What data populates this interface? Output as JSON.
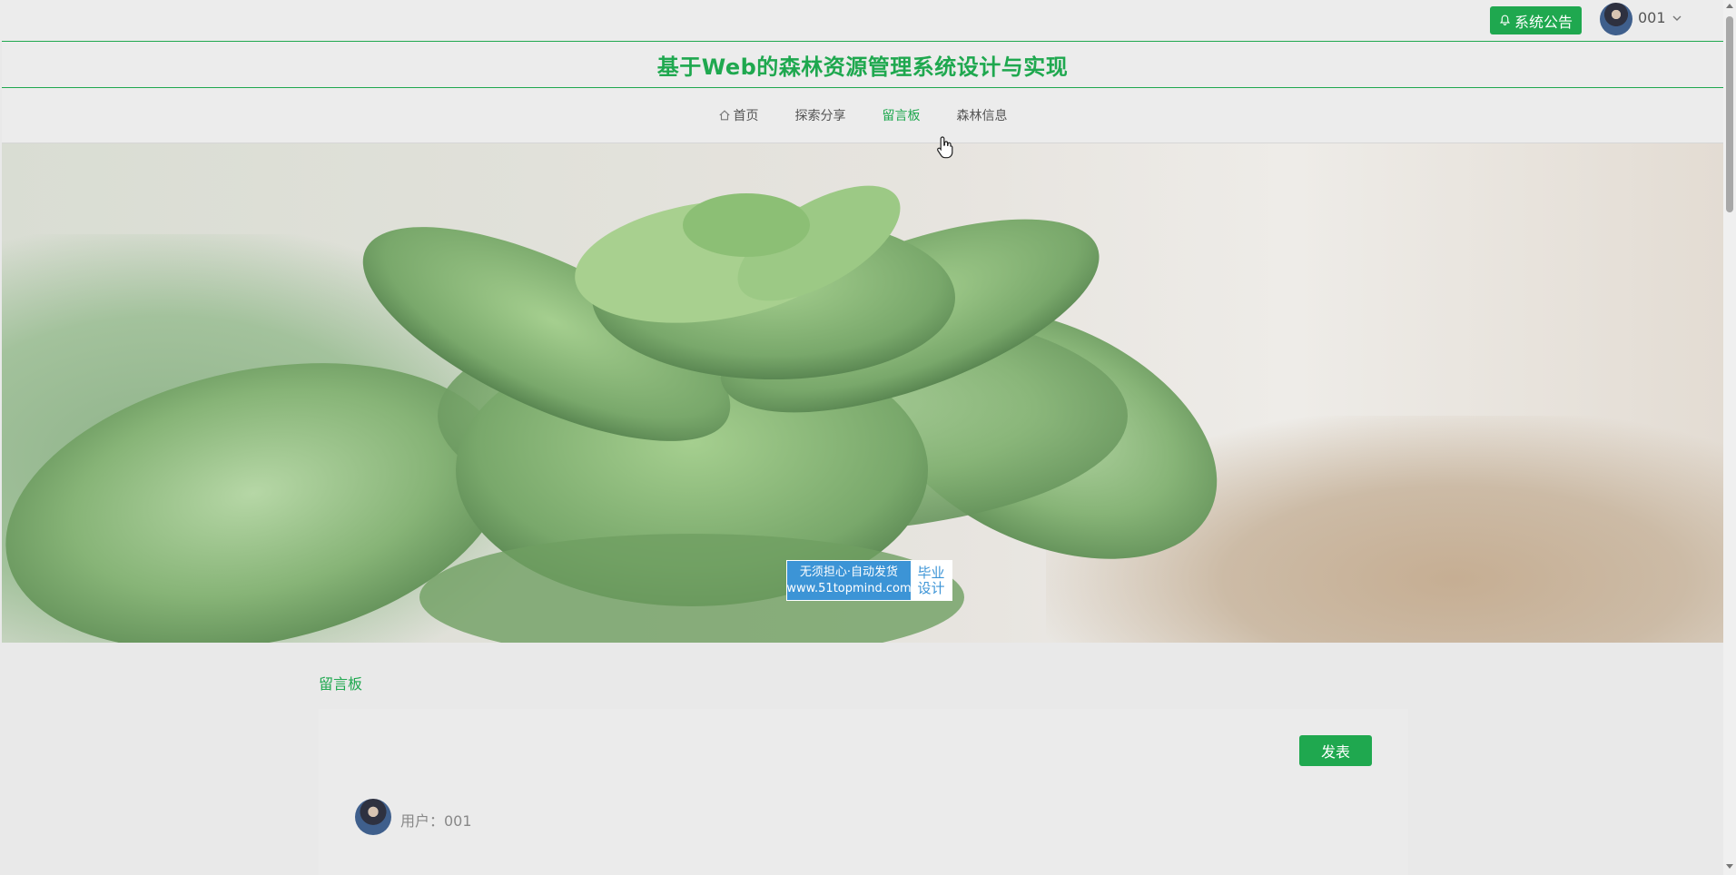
{
  "header": {
    "notice_button": "系统公告",
    "username": "001",
    "icons": {
      "notice": "bell-icon",
      "dropdown": "chevron-down-icon"
    }
  },
  "site": {
    "title": "基于Web的森林资源管理系统设计与实现"
  },
  "nav": {
    "items": [
      {
        "label": "首页",
        "icon": "home-icon"
      },
      {
        "label": "探索分享"
      },
      {
        "label": "留言板",
        "active": true
      },
      {
        "label": "森林信息"
      }
    ]
  },
  "banner": {
    "watermark": {
      "line1": "无须担心·自动发货",
      "line2": "www.51topmind.com",
      "badge_line1": "毕业",
      "badge_line2": "设计"
    }
  },
  "board": {
    "section_label": "留言板",
    "post_button": "发表",
    "message": {
      "user": "用户：001"
    }
  },
  "colors": {
    "brand": "#1fa84f",
    "watermark_blue": "#3c94d6"
  }
}
